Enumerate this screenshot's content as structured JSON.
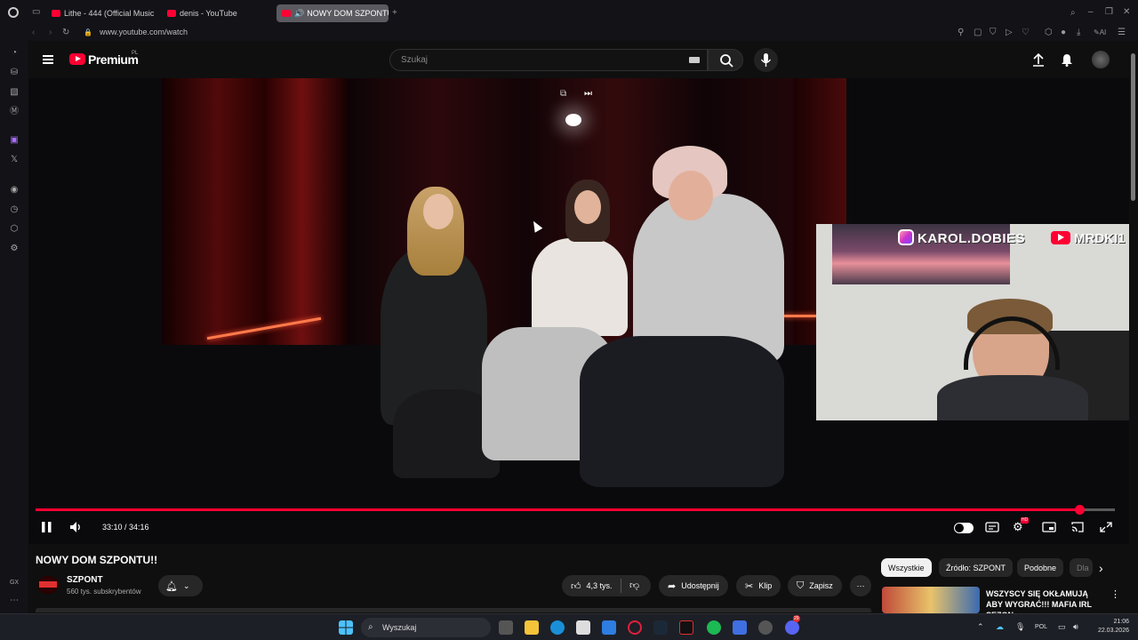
{
  "browser": {
    "tabs": [
      {
        "label": "Lithe - 444 (Official Music",
        "active": false
      },
      {
        "label": "denis - YouTube",
        "active": false
      },
      {
        "label": "NOWY DOM SZPONTU",
        "active": true
      }
    ],
    "url": "www.youtube.com/watch",
    "ai_label": "AI"
  },
  "header": {
    "logo_text": "Premium",
    "logo_country": "PL",
    "search_placeholder": "Szukaj"
  },
  "player": {
    "current_time": "33:10",
    "duration": "34:16",
    "time_display": "33:10 / 34:16",
    "progress_fraction": 0.9674,
    "settings_badge": "HD"
  },
  "overlay": {
    "instagram_handle": "KAROL.DOBIES",
    "youtube_handle": "MRDKI1"
  },
  "video": {
    "title": "NOWY DOM SZPONTU!!",
    "channel_name": "SZPONT",
    "subscribers": "560 tys. subskrybentów",
    "likes": "4,3 tys.",
    "share_label": "Udostępnij",
    "clip_label": "Klip",
    "save_label": "Zapisz"
  },
  "chips": [
    "Wszystkie",
    "Źródło: SZPONT",
    "Podobne",
    "Dla"
  ],
  "recommendation": {
    "title": "WSZYSCY SIĘ OKŁAMUJĄ ABY WYGRAĆ!!! MAFIA IRL SEZON ..."
  },
  "taskbar": {
    "search_label": "Wyszukaj",
    "language": "POL",
    "time": "21:06",
    "date": "22.03.2026",
    "notification_badge": "29"
  },
  "sidebar": {
    "gx_label": "GX"
  },
  "colors": {
    "accent": "#ff0033",
    "background": "#0f0f0f"
  }
}
